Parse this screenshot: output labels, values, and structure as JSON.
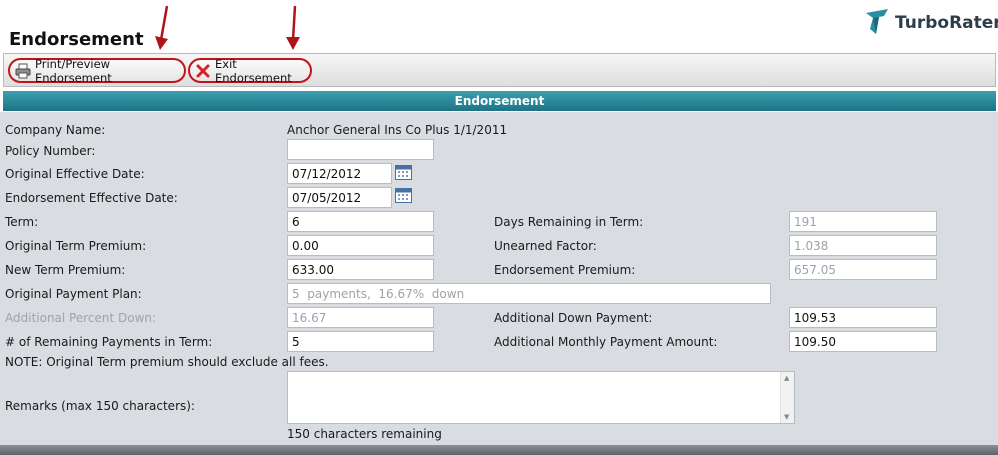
{
  "header": {
    "title": "Endorsement",
    "logo_text": "TurboRater"
  },
  "toolbar": {
    "print_label": "Print/Preview Endorsement",
    "exit_label": "Exit Endorsement"
  },
  "section": {
    "title": "Endorsement"
  },
  "form": {
    "company_name_label": "Company Name:",
    "company_name_value": "Anchor General Ins Co Plus 1/1/2011",
    "policy_number_label": "Policy Number:",
    "policy_number_value": "",
    "original_effective_label": "Original Effective Date:",
    "original_effective_value": "07/12/2012",
    "endorsement_effective_label": "Endorsement Effective Date:",
    "endorsement_effective_value": "07/05/2012",
    "term_label": "Term:",
    "term_value": "6",
    "days_remaining_label": "Days Remaining in Term:",
    "days_remaining_value": "191",
    "original_term_premium_label": "Original Term Premium:",
    "original_term_premium_value": "0.00",
    "unearned_factor_label": "Unearned Factor:",
    "unearned_factor_value": "1.038",
    "new_term_premium_label": "New Term Premium:",
    "new_term_premium_value": "633.00",
    "endorsement_premium_label": "Endorsement Premium:",
    "endorsement_premium_value": "657.05",
    "payment_plan_label": "Original Payment Plan:",
    "payment_plan_value": "5  payments,  16.67%  down",
    "additional_percent_label": "Additional Percent Down:",
    "additional_percent_value": "16.67",
    "additional_down_label": "Additional Down Payment:",
    "additional_down_value": "109.53",
    "remaining_payments_label": "# of Remaining Payments in Term:",
    "remaining_payments_value": "5",
    "additional_monthly_label": "Additional Monthly Payment Amount:",
    "additional_monthly_value": "109.50",
    "note": "NOTE: Original Term premium should exclude all fees.",
    "remarks_label": "Remarks (max 150 characters):",
    "remarks_value": "",
    "remarks_counter": "150 characters remaining"
  },
  "colors": {
    "section_header": "#2a8797",
    "form_background": "#d9dde2",
    "highlight_outline": "#c0141d",
    "arrow": "#b0141b"
  }
}
